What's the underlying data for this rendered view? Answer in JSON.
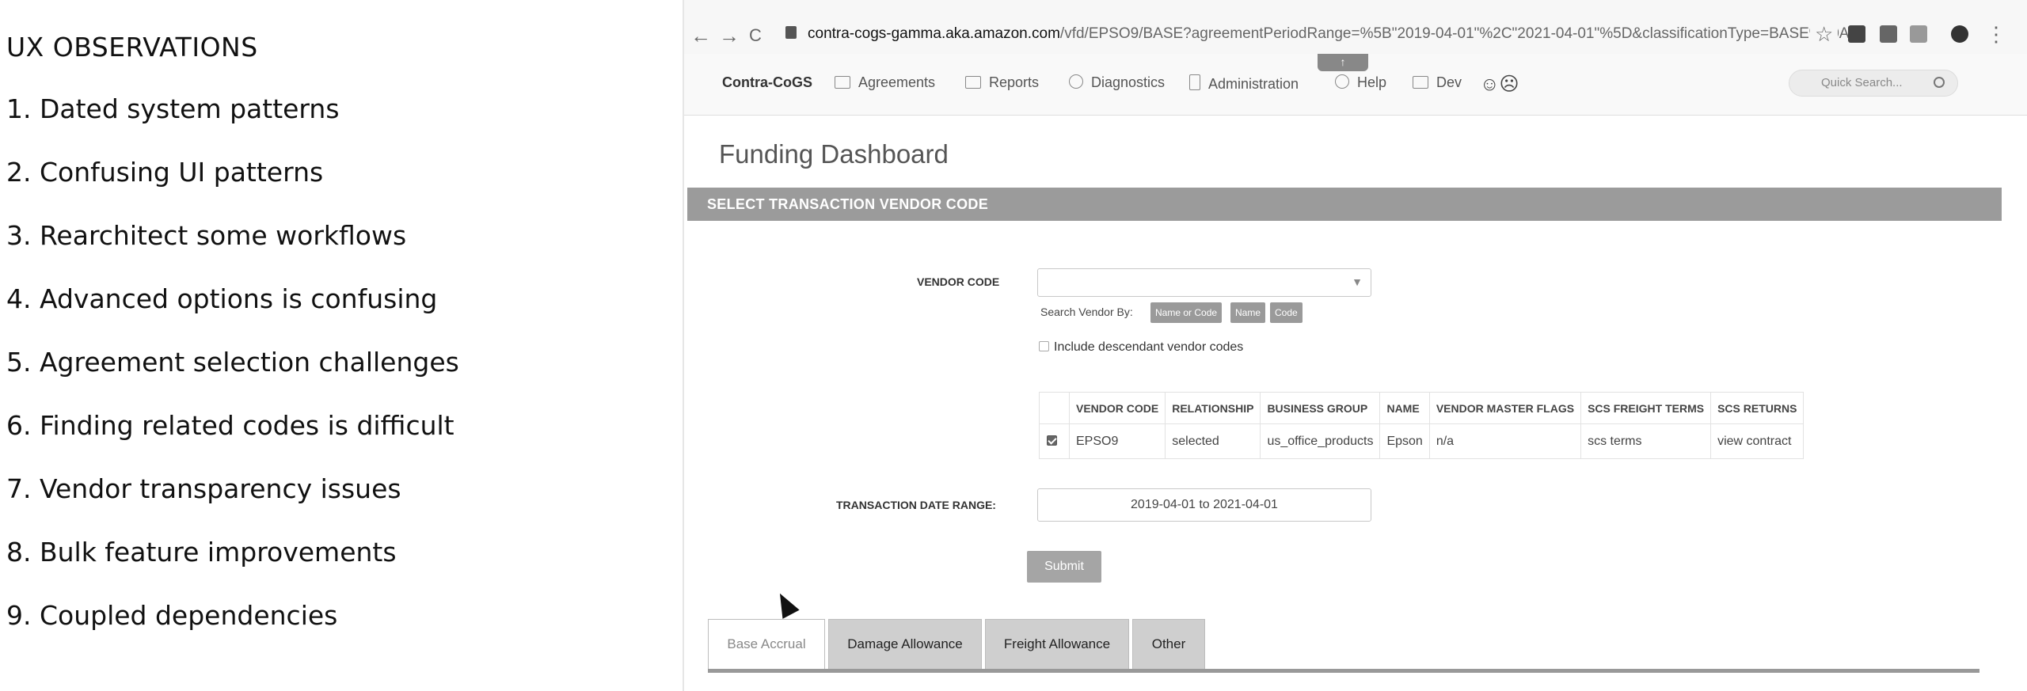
{
  "observations": {
    "title": "UX OBSERVATIONS",
    "items": [
      "1. Dated system patterns",
      "2. Confusing UI patterns",
      "3. Rearchitect some workflows",
      "4. Advanced options is confusing",
      "5. Agreement selection challenges",
      "6. Finding related codes is difficult",
      "7. Vendor transparency issues",
      "8. Bulk feature improvements",
      "9. Coupled dependencies"
    ]
  },
  "browser": {
    "url_domain": "contra-cogs-gamma.aka.amazon.com",
    "url_path": "/vfd/EPSO9/BASE?agreementPeriodRange=%5B\"2019-04-01\"%2C\"2021-04-01\"%5D&classificationType=BASE%20A...",
    "back": "←",
    "forward": "→",
    "reload": "C",
    "star": "☆",
    "menu": "⋮"
  },
  "app_nav": {
    "brand": "Contra-CoGS",
    "items": [
      "Agreements",
      "Reports",
      "Diagnostics",
      "Administration",
      "Help",
      "Dev"
    ],
    "tip_label": "↑",
    "search_placeholder": "Quick Search..."
  },
  "page": {
    "title": "Funding Dashboard",
    "section": "SELECT TRANSACTION VENDOR CODE",
    "vendor_code_label": "VENDOR CODE",
    "vendor_code_value": "",
    "search_by_label": "Search Vendor By:",
    "search_by_options": [
      "Name or Code",
      "Name",
      "Code"
    ],
    "descendant_label": "Include descendant vendor codes",
    "table": {
      "headers": [
        "VENDOR CODE",
        "RELATIONSHIP",
        "BUSINESS GROUP",
        "NAME",
        "VENDOR MASTER FLAGS",
        "SCS FREIGHT TERMS",
        "SCS RETURNS"
      ],
      "rows": [
        [
          "EPSO9",
          "selected",
          "us_office_products",
          "Epson",
          "n/a",
          "scs terms",
          "view contract"
        ]
      ]
    },
    "date_range_label": "TRANSACTION DATE RANGE:",
    "date_range_value": "2019-04-01 to 2021-04-01",
    "submit_label": "Submit",
    "tabs": [
      "Base Accrual",
      "Damage Allowance",
      "Freight Allowance",
      "Other"
    ],
    "active_tab": "Base Accrual"
  }
}
